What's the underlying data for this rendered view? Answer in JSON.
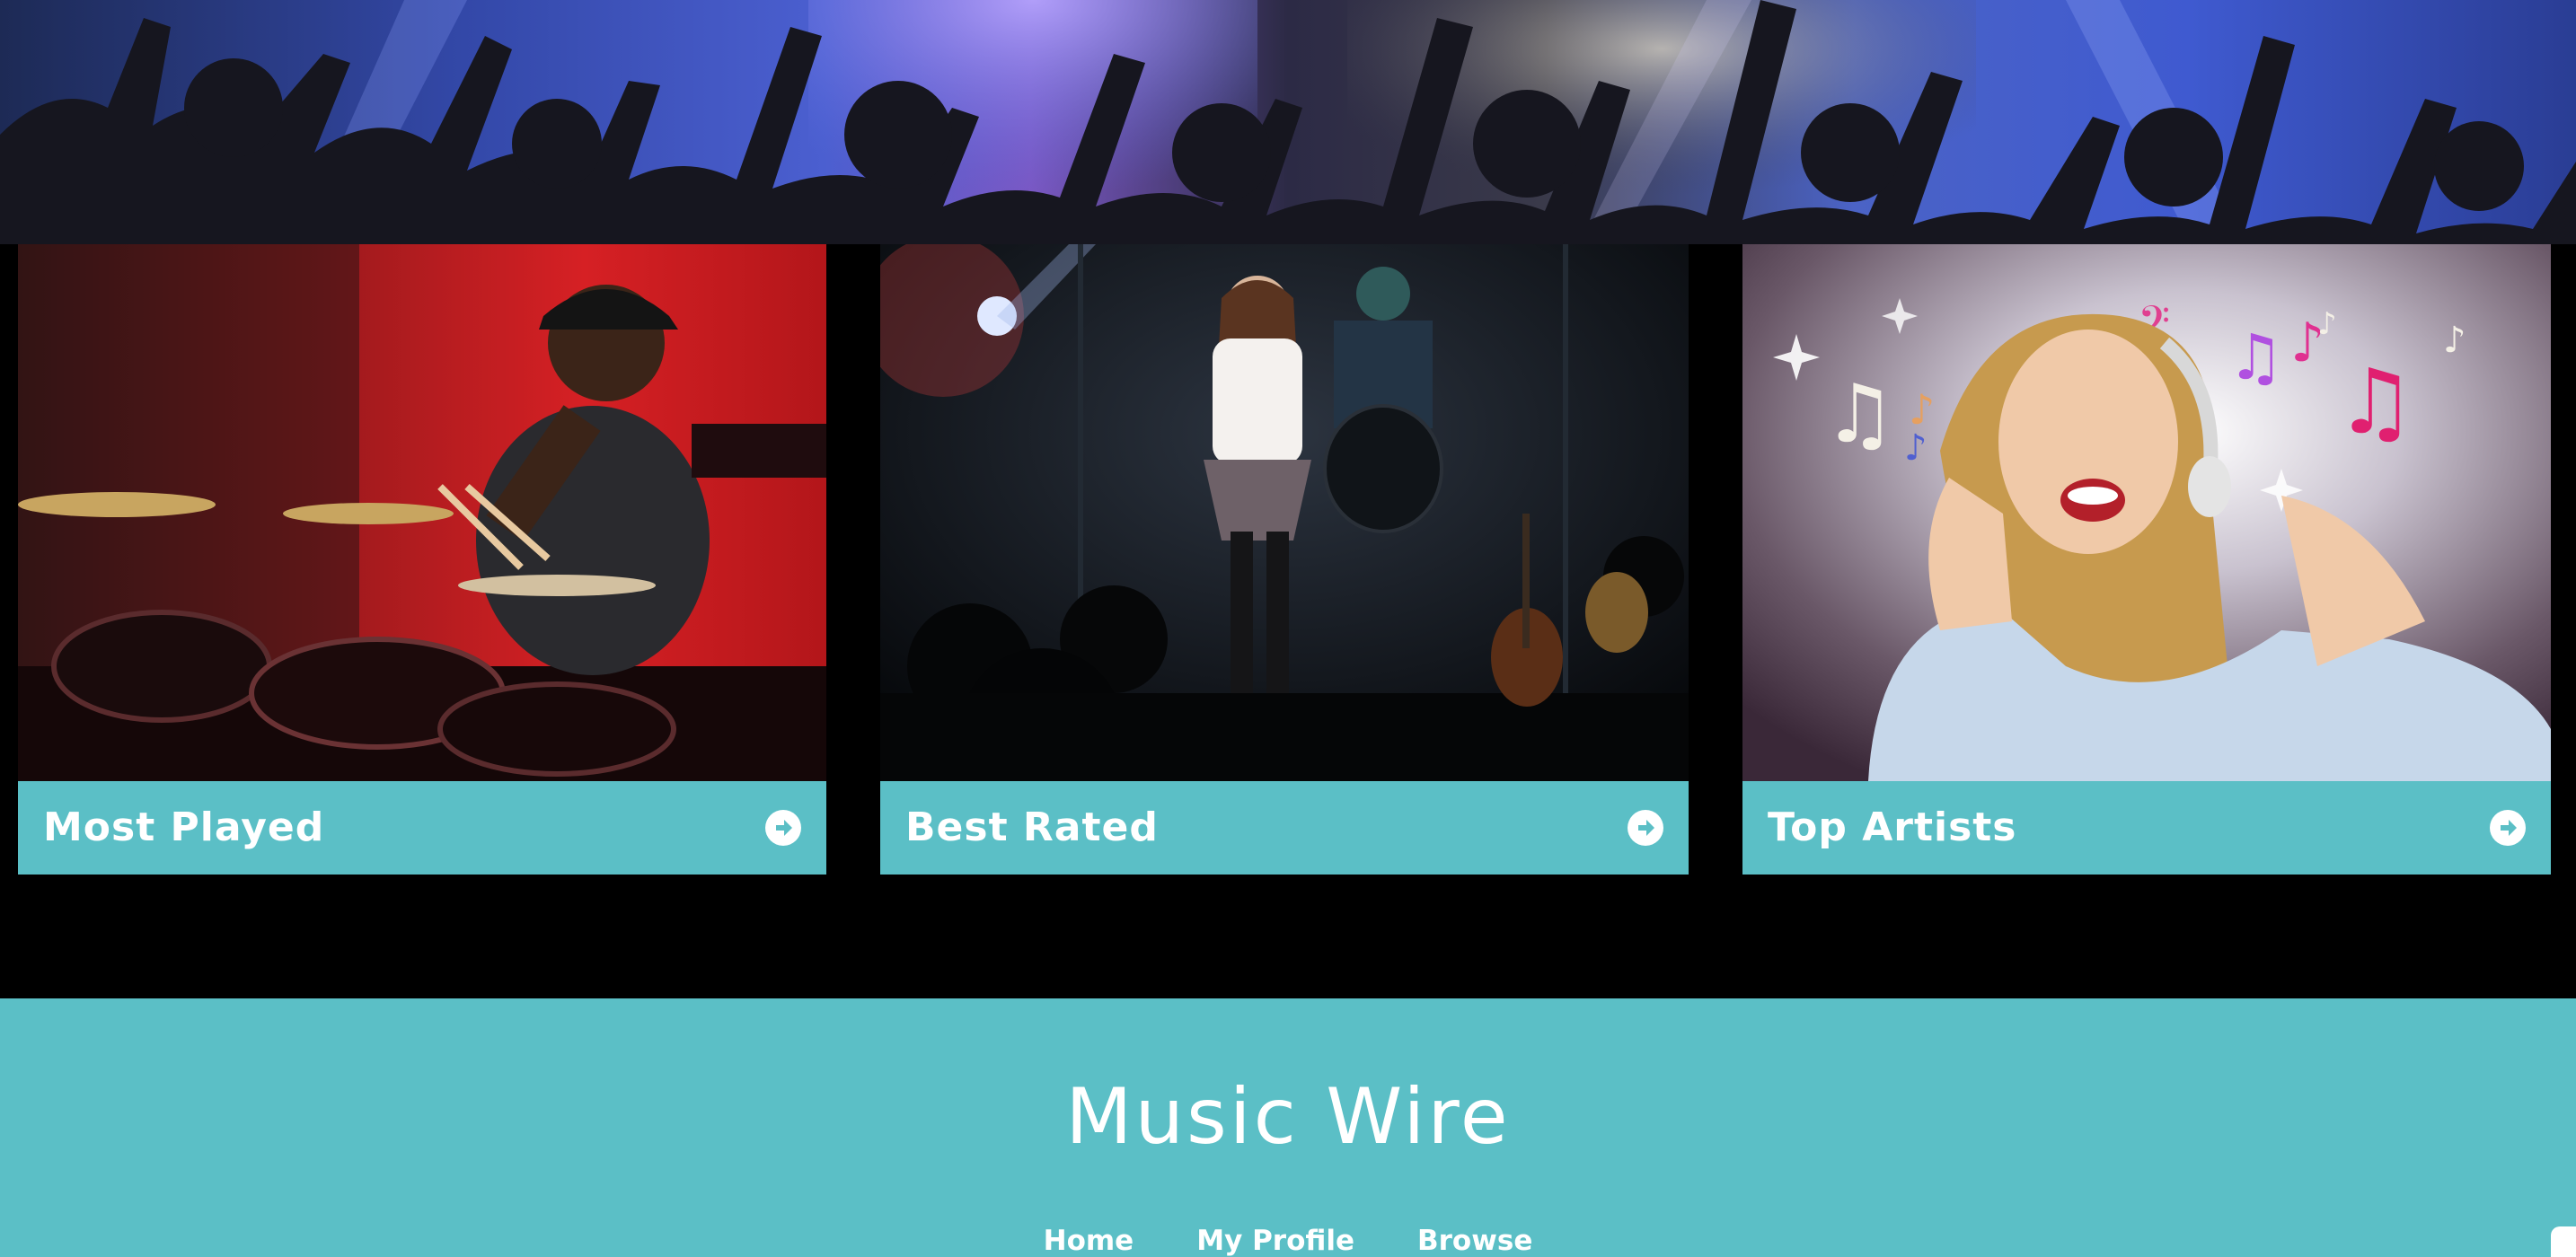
{
  "colors": {
    "accent": "#5bbfc6",
    "page_background": "#000000",
    "text": "#ffffff"
  },
  "hero": {
    "image": "concert-crowd-silhouettes"
  },
  "cards": [
    {
      "title": "Most Played",
      "image": "drummer-on-red-stage",
      "icon": "arrow-circle-right-icon"
    },
    {
      "title": "Best Rated",
      "image": "singer-on-dark-stage",
      "icon": "arrow-circle-right-icon"
    },
    {
      "title": "Top Artists",
      "image": "woman-with-headphones-and-music-notes",
      "icon": "arrow-circle-right-icon"
    }
  ],
  "footer": {
    "title": "Music Wire",
    "nav": [
      "Home",
      "My Profile",
      "Browse"
    ]
  }
}
